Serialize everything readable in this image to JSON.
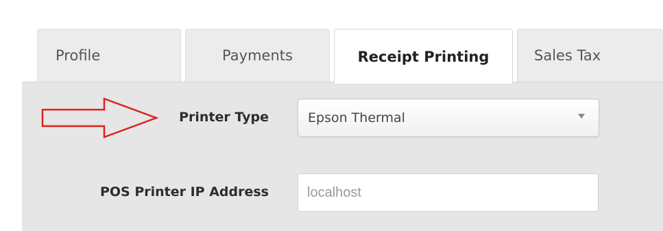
{
  "tabs": [
    {
      "label": "Profile"
    },
    {
      "label": "Payments"
    },
    {
      "label": "Receipt Printing"
    },
    {
      "label": "Sales Tax"
    }
  ],
  "active_tab": "Receipt Printing",
  "form": {
    "printer_type": {
      "label": "Printer Type",
      "value": "Epson Thermal"
    },
    "ip_address": {
      "label": "POS Printer IP Address",
      "placeholder": "localhost"
    }
  },
  "annotation": {
    "icon": "right-arrow-icon",
    "color": "#e0201b"
  }
}
